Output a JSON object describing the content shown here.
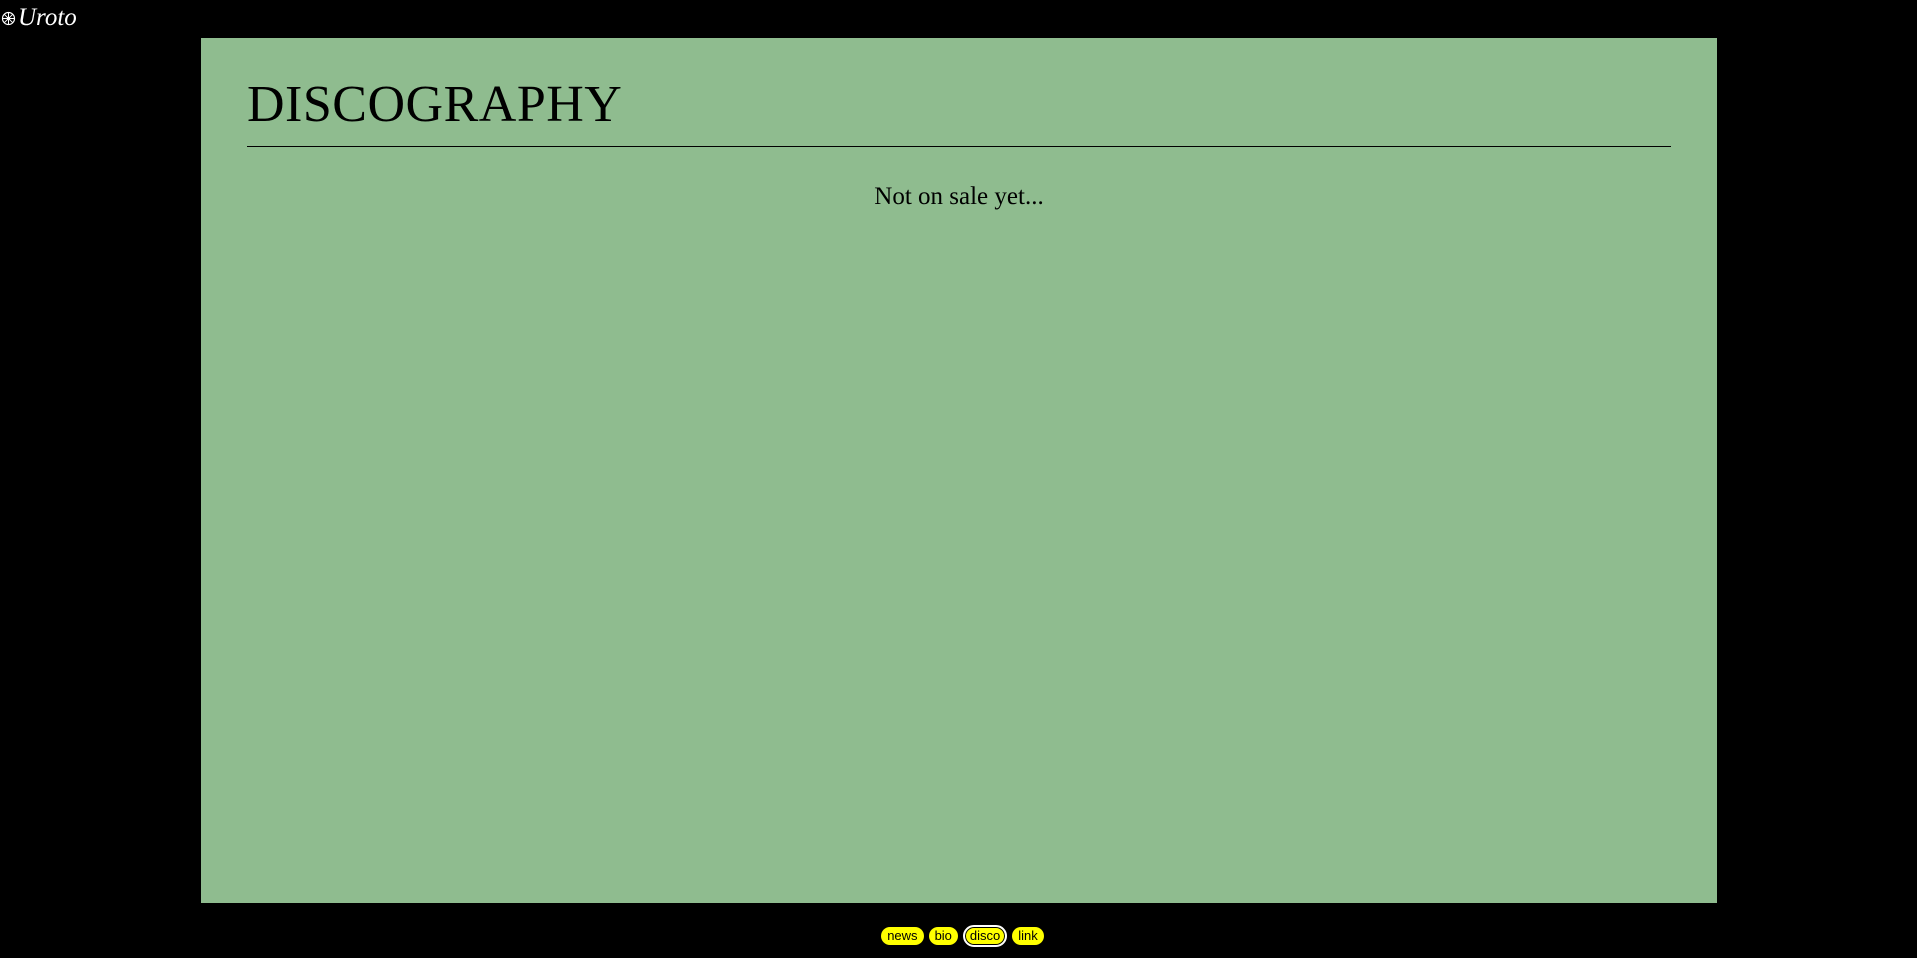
{
  "site": {
    "logo_text": "Uroto",
    "logo_icon": "wheel-icon"
  },
  "main": {
    "title": "DISCOGRAPHY",
    "status_text": "Not on sale yet..."
  },
  "footer_nav": {
    "items": [
      {
        "label": "news"
      },
      {
        "label": "bio"
      },
      {
        "label": "disco",
        "active": true
      },
      {
        "label": "link"
      }
    ]
  },
  "colors": {
    "page_background": "#000000",
    "panel_background": "#8fbc8f",
    "nav_pill_background": "#ffff00",
    "logo_text": "#ffffff"
  }
}
